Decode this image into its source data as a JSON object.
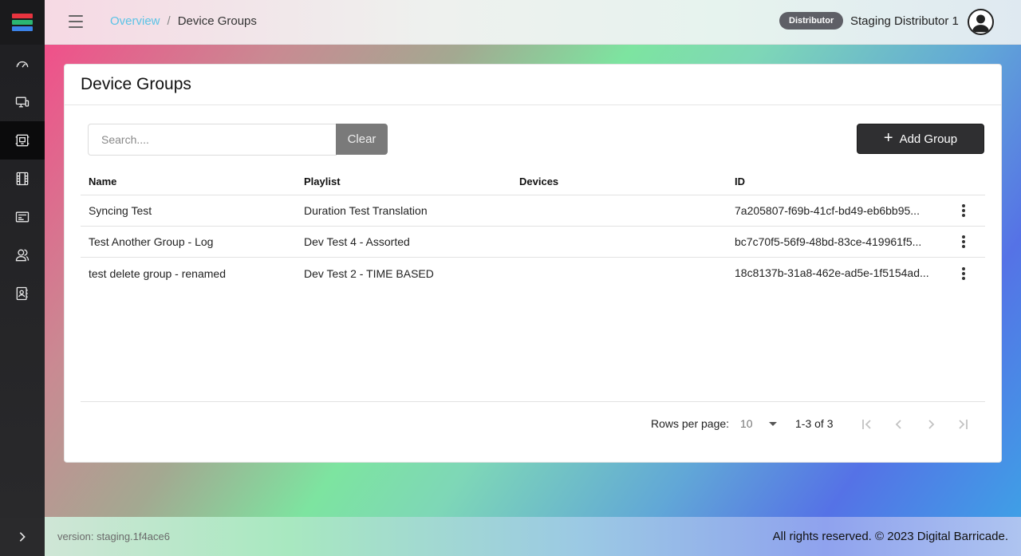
{
  "header": {
    "breadcrumb_link": "Overview",
    "breadcrumb_separator": "/",
    "breadcrumb_current": "Device Groups",
    "role_badge": "Distributor",
    "user_name": "Staging Distributor 1"
  },
  "sidebar": {
    "logo_colors": [
      "#e8343f",
      "#2bb673",
      "#3b82e8"
    ],
    "items": [
      {
        "icon": "dashboard-gauge-icon",
        "active": false
      },
      {
        "icon": "devices-icon",
        "active": false
      },
      {
        "icon": "device-groups-icon",
        "active": true
      },
      {
        "icon": "film-icon",
        "active": false
      },
      {
        "icon": "media-card-icon",
        "active": false
      },
      {
        "icon": "users-icon",
        "active": false
      },
      {
        "icon": "contacts-book-icon",
        "active": false
      }
    ],
    "collapse_icon": "chevron-right-icon"
  },
  "card": {
    "title": "Device Groups",
    "search_placeholder": "Search....",
    "clear_label": "Clear",
    "add_label": "Add Group"
  },
  "table": {
    "columns": [
      "Name",
      "Playlist",
      "Devices",
      "ID"
    ],
    "rows": [
      {
        "name": "Syncing Test",
        "playlist": "Duration Test Translation",
        "devices": "",
        "id": "7a205807-f69b-41cf-bd49-eb6bb95..."
      },
      {
        "name": "Test Another Group - Log",
        "playlist": "Dev Test 4 - Assorted",
        "devices": "",
        "id": "bc7c70f5-56f9-48bd-83ce-419961f5..."
      },
      {
        "name": "test delete group - renamed",
        "playlist": "Dev Test 2 - TIME BASED",
        "devices": "",
        "id": "18c8137b-31a8-462e-ad5e-1f5154ad..."
      }
    ]
  },
  "pagination": {
    "rows_per_page_label": "Rows per page:",
    "rows_per_page_value": "10",
    "page_info": "1-3 of 3"
  },
  "footer": {
    "version": "version: staging.1f4ace6",
    "copyright": "All rights reserved. © 2023 Digital Barricade."
  }
}
